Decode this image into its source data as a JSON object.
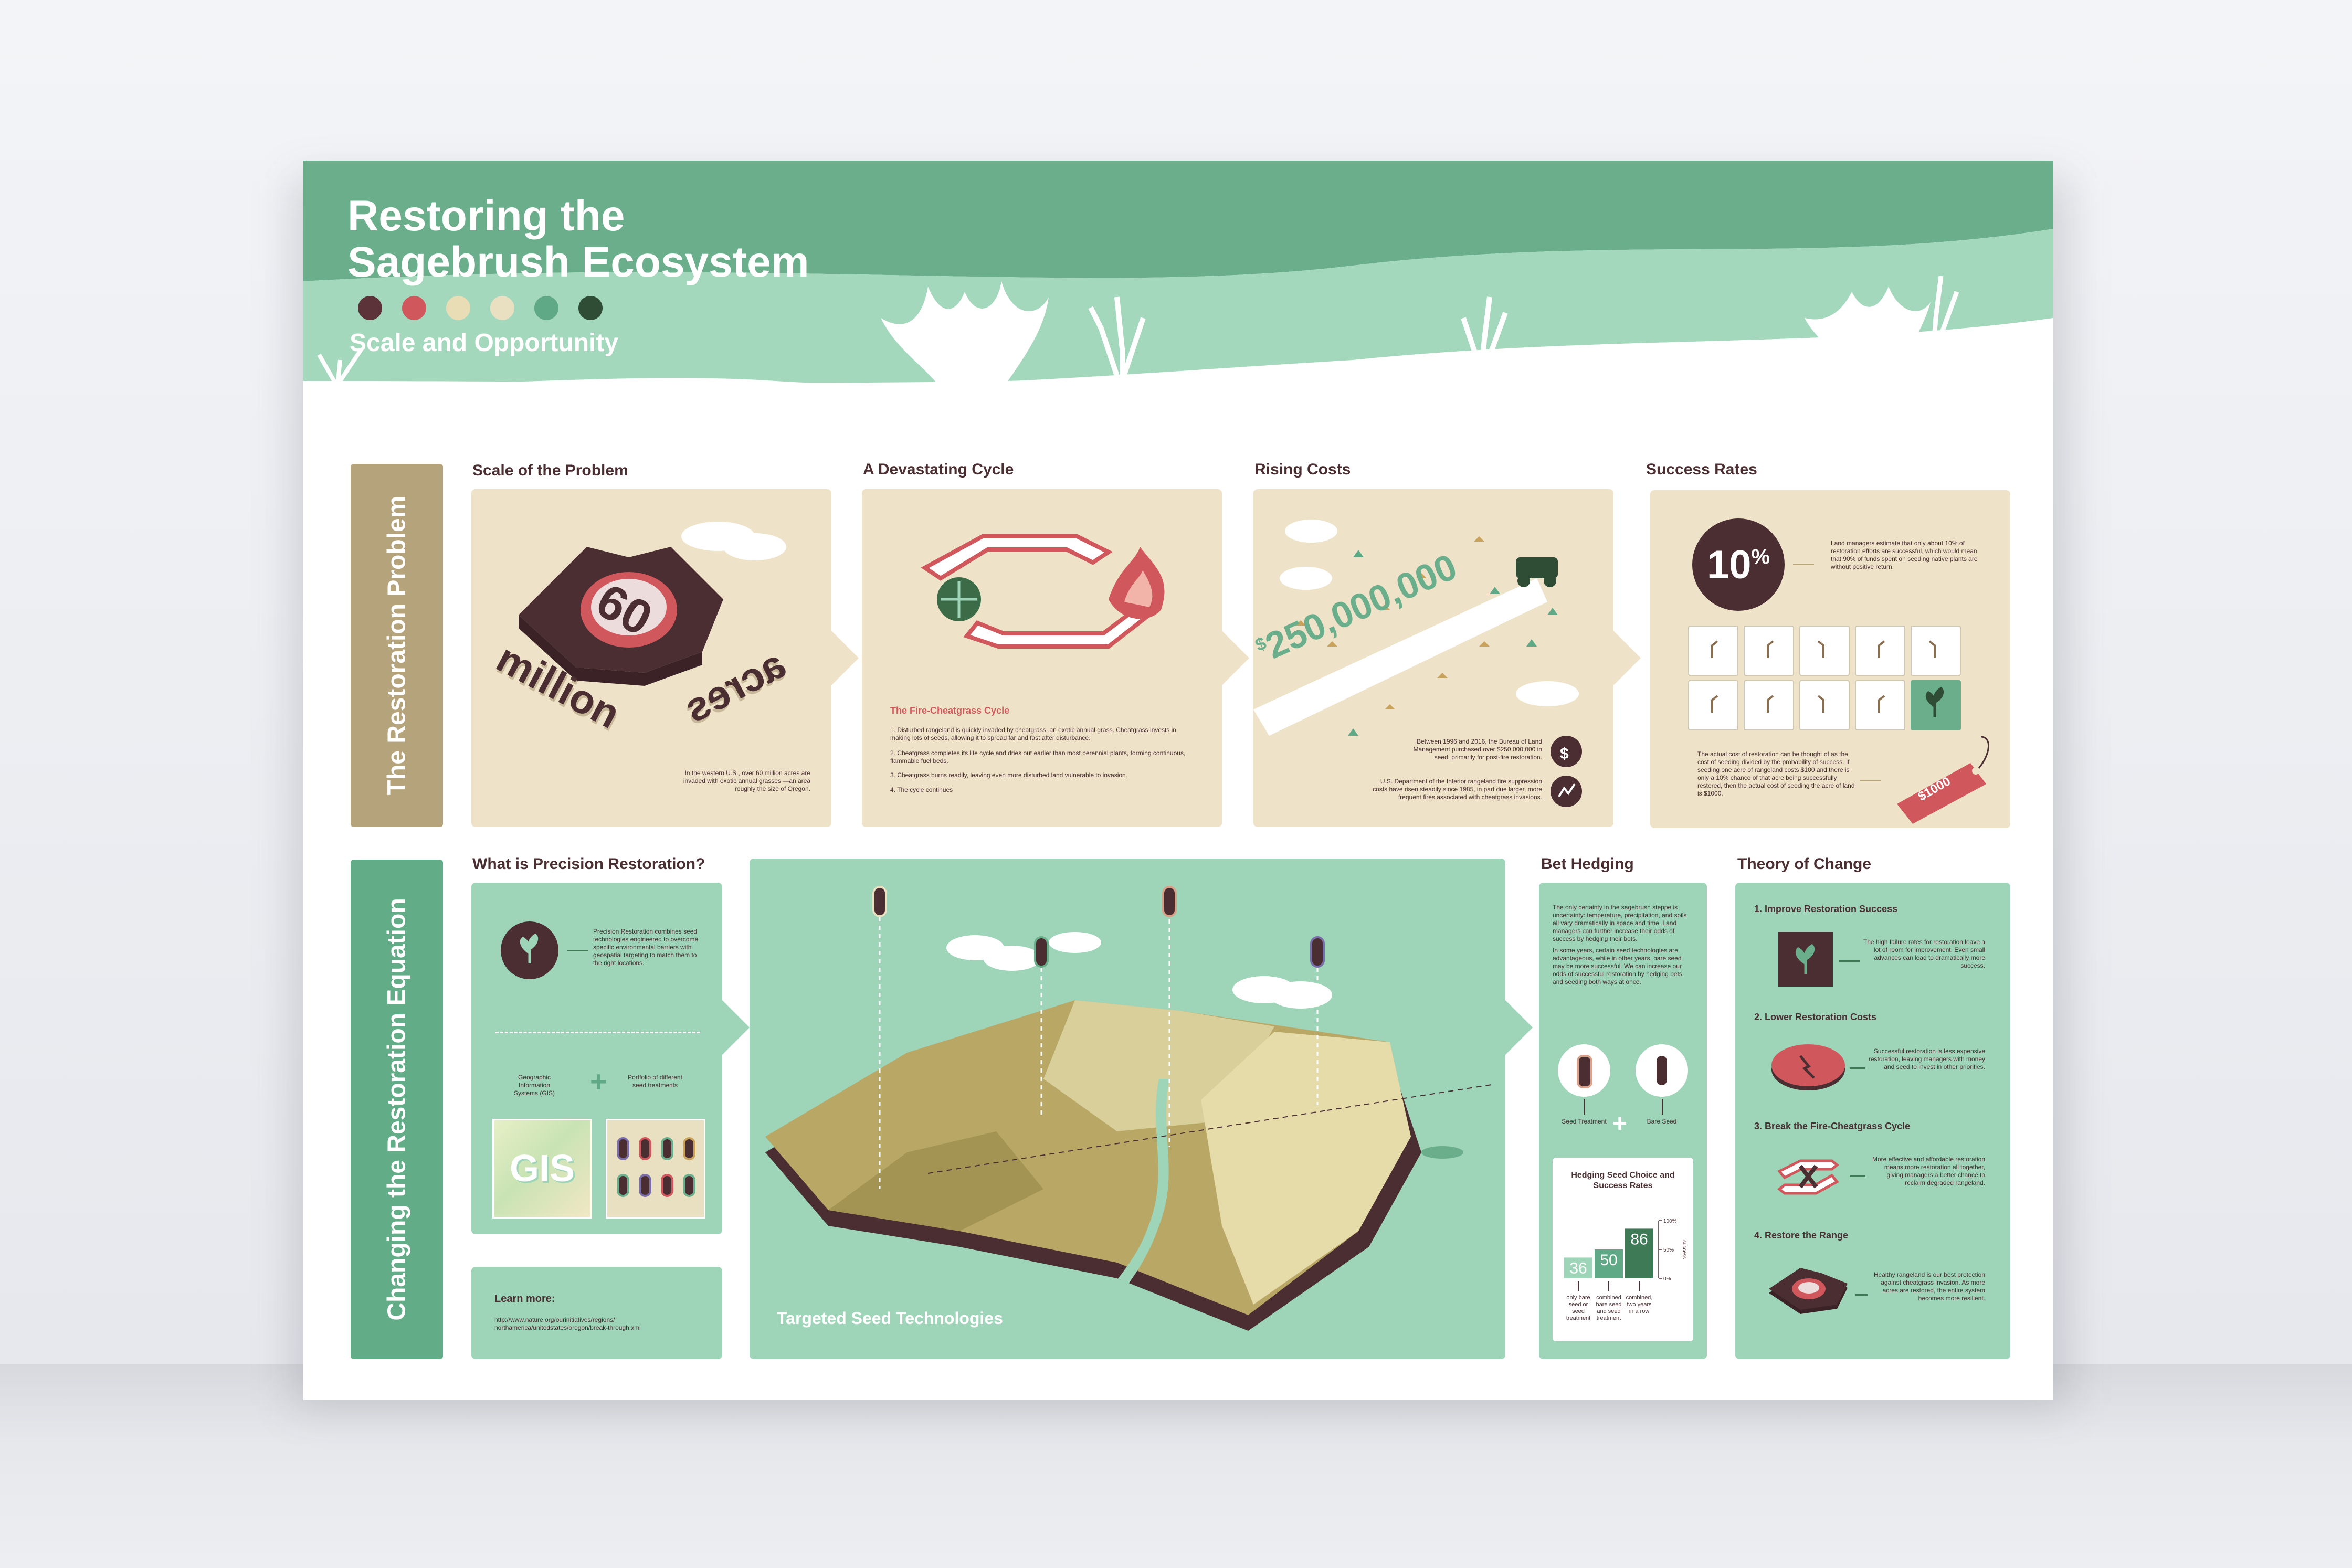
{
  "poster": {
    "title_line1": "Restoring the",
    "title_line2": "Sagebrush Ecosystem",
    "subtitle": "Scale and Opportunity",
    "swatches": [
      "#5b3338",
      "#d0575c",
      "#e8ddb5",
      "#e9e0c2",
      "#5fa987",
      "#2f4d34"
    ]
  },
  "colors": {
    "header_green": "#6aae8b",
    "header_light": "#a4d8bd",
    "beige": "#eee3c9",
    "mint": "#9ed4b8",
    "maroon": "#5b3338",
    "red": "#d0575c",
    "sidebar_tan": "#b5a47b",
    "sidebar_green": "#62ad88"
  },
  "problem": {
    "sidebar_label": "The Restoration Problem",
    "scale": {
      "title": "Scale of the Problem",
      "number": "60",
      "word1": "million",
      "word2": "acres",
      "caption": "In the western U.S., over 60 million acres are invaded with exotic annual grasses —an area roughly the size of Oregon."
    },
    "cycle": {
      "title": "A Devastating Cycle",
      "subtitle": "The Fire-Cheatgrass Cycle",
      "steps": [
        "1. Disturbed rangeland is quickly invaded by cheatgrass, an exotic annual grass. Cheatgrass invests in making lots of seeds, allowing it to spread far and fast after disturbance.",
        "2. Cheatgrass completes its life cycle and dries out earlier than most perennial plants, forming continuous, flammable fuel beds.",
        "3. Cheatgrass burns readily, leaving even more disturbed land vulnerable to invasion.",
        "4. The cycle continues"
      ]
    },
    "costs": {
      "title": "Rising Costs",
      "amount_prefix": "$",
      "amount": "250,000,000",
      "fact1": "Between 1996 and 2016, the Bureau of Land Management purchased over $250,000,000 in seed, primarily for post-fire restoration.",
      "fact2": "U.S. Department of the Interior rangeland fire suppression costs have risen steadily since 1985, in part due larger, more frequent fires associated with cheatgrass invasions."
    },
    "success": {
      "title": "Success Rates",
      "percent": "10",
      "percent_sign": "%",
      "note": "Land managers estimate that only about 10% of restoration efforts are successful, which would mean that 90% of funds spent on seeding native plants are without positive return.",
      "cost_note": "The actual cost of restoration can be thought of as the cost of seeding divided by the probability of success. If seeding one acre of rangeland costs $100 and there is only a 10% chance of that acre being successfully restored, then the actual cost of seeding the acre of land is $1000.",
      "tag": "$1000"
    }
  },
  "equation": {
    "sidebar_label": "Changing the Restoration Equation",
    "precision": {
      "title": "What is Precision Restoration?",
      "text": "Precision Restoration combines seed technologies engineered to overcome specific environmental barriers with geospatial targeting to match them to the right locations.",
      "gis_label": "Geographic Information Systems (GIS)",
      "portfolio_label": "Portfolio of different seed treatments",
      "gis_tile": "GIS"
    },
    "learn": {
      "title": "Learn more:",
      "url": "http://www.nature.org/ourinitiatives/regions/ northamerica/unitedstates/oregon/break-through.xml"
    },
    "map": {
      "caption": "Targeted Seed Technologies"
    },
    "bet": {
      "title": "Bet Hedging",
      "text1": "The only certainty in the sagebrush steppe is uncertainty: temperature, precipitation, and soils all vary dramatically in space and time. Land managers can further increase their odds of success by hedging their bets.",
      "text2": "In some years, certain seed technologies are advantageous, while in other years, bare seed may be more successful. We can increase our odds of successful restoration by hedging bets and seeding both ways at once.",
      "seed_treatment": "Seed Treatment",
      "bare_seed": "Bare Seed",
      "plus": "+",
      "chart_title": "Hedging Seed Choice and Success Rates",
      "axis_label": "success"
    },
    "theory": {
      "title": "Theory of Change",
      "items": [
        {
          "heading": "1. Improve Restoration Success",
          "text": "The high failure rates for restoration leave a lot of room for improvement. Even small advances can lead to dramatically more success."
        },
        {
          "heading": "2. Lower Restoration Costs",
          "text": "Successful restoration is less expensive restoration, leaving managers with money and seed to invest in other priorities."
        },
        {
          "heading": "3. Break the Fire-Cheatgrass Cycle",
          "text": "More effective and affordable restoration means more restoration all together, giving managers a better chance to reclaim degraded rangeland."
        },
        {
          "heading": "4. Restore the Range",
          "text": "Healthy rangeland is our best protection against cheatgrass invasion. As more acres are restored, the entire system becomes more resilient."
        }
      ]
    }
  },
  "chart_data": {
    "type": "bar",
    "title": "Hedging Seed Choice and Success Rates",
    "categories": [
      "only bare seed or seed treatment",
      "combined bare seed and seed treatment",
      "combined, two years in a row"
    ],
    "values": [
      36,
      50,
      86
    ],
    "ylabel": "success",
    "yticks": [
      "100%",
      "50%",
      "0%"
    ],
    "ylim": [
      0,
      100
    ],
    "colors": [
      "#9ed4b8",
      "#5fa987",
      "#3e7a55"
    ]
  }
}
